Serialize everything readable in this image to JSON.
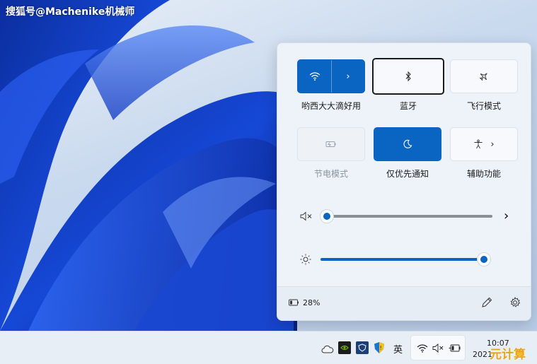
{
  "watermark": "搜狐号@Machenike机械师",
  "quick_settings": {
    "tiles": [
      {
        "label": "哟西大大滴好用",
        "icon": "wifi-icon",
        "state": "on",
        "has_expand": true
      },
      {
        "label": "蓝牙",
        "icon": "bluetooth-icon",
        "state": "off"
      },
      {
        "label": "飞行模式",
        "icon": "airplane-icon",
        "state": "off"
      },
      {
        "label": "节电模式",
        "icon": "battery-saver-icon",
        "state": "disabled"
      },
      {
        "label": "仅优先通知",
        "icon": "moon-icon",
        "state": "on"
      },
      {
        "label": "辅助功能",
        "icon": "accessibility-icon",
        "state": "off",
        "has_expand": true
      }
    ],
    "volume": {
      "icon": "speaker-muted-icon",
      "level": 0,
      "expand": "chevron-right-icon"
    },
    "brightness": {
      "icon": "sun-icon",
      "level": 100
    },
    "battery": {
      "icon": "battery-icon",
      "text": "28%"
    },
    "edit_icon": "pencil-icon",
    "settings_icon": "gear-icon"
  },
  "taskbar": {
    "tray_icons": [
      "cloud-icon",
      "nvidia-icon",
      "defender-icon",
      "security-shield-icon"
    ],
    "ime": "英",
    "network_group": [
      "wifi-icon",
      "speaker-muted-icon",
      "battery-plug-icon"
    ],
    "clock_time": "10:07",
    "clock_date": "2021",
    "corner_text": "元计算"
  },
  "colors": {
    "accent": "#0a64c2",
    "panel_bg": "#eef3f9",
    "taskbar_bg": "#e8eef6"
  }
}
